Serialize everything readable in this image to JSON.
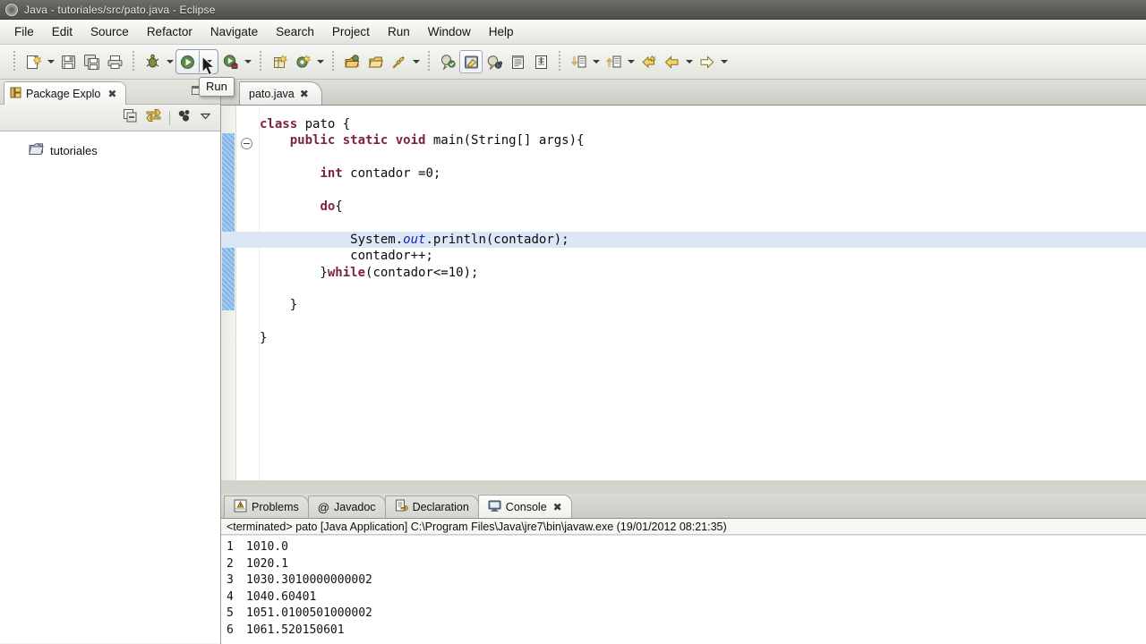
{
  "window": {
    "title": "Java - tutoriales/src/pato.java - Eclipse",
    "app_icon": "eclipse-icon"
  },
  "menubar": {
    "items": [
      {
        "label": "File"
      },
      {
        "label": "Edit"
      },
      {
        "label": "Source"
      },
      {
        "label": "Refactor"
      },
      {
        "label": "Navigate"
      },
      {
        "label": "Search"
      },
      {
        "label": "Project"
      },
      {
        "label": "Run"
      },
      {
        "label": "Window"
      },
      {
        "label": "Help"
      }
    ]
  },
  "toolbar": {
    "tooltip": "Run",
    "buttons": [
      {
        "name": "new-wizard-icon"
      },
      {
        "name": "new-wizard-dropdown-icon"
      },
      {
        "name": "save-icon"
      },
      {
        "name": "save-all-icon"
      },
      {
        "name": "print-icon"
      },
      {
        "name": "debug-icon"
      },
      {
        "name": "debug-dropdown-icon"
      },
      {
        "name": "run-icon"
      },
      {
        "name": "run-dropdown-icon"
      },
      {
        "name": "external-tools-icon"
      },
      {
        "name": "external-tools-dropdown-icon"
      },
      {
        "name": "new-java-project-icon"
      },
      {
        "name": "new-class-icon"
      },
      {
        "name": "new-class-dropdown-icon"
      },
      {
        "name": "open-type-icon"
      },
      {
        "name": "open-task-icon"
      },
      {
        "name": "search-icon"
      },
      {
        "name": "search-dropdown-icon"
      },
      {
        "name": "toggle-mark-occurrences-icon"
      },
      {
        "name": "skip-all-breakpoints-icon"
      },
      {
        "name": "toggle-breadcrumb-icon"
      },
      {
        "name": "show-whitespace-icon"
      },
      {
        "name": "next-annotation-icon"
      },
      {
        "name": "next-annotation-dropdown-icon"
      },
      {
        "name": "previous-annotation-icon"
      },
      {
        "name": "previous-annotation-dropdown-icon"
      },
      {
        "name": "last-edit-location-icon"
      },
      {
        "name": "back-icon"
      },
      {
        "name": "back-dropdown-icon"
      },
      {
        "name": "forward-icon"
      },
      {
        "name": "forward-dropdown-icon"
      }
    ]
  },
  "left_panel": {
    "tab_label": "Package Explo",
    "tab_icon": "package-explorer-icon",
    "close_label": "✖",
    "toolbar_icons": [
      "collapse-all-icon",
      "link-with-editor-icon",
      "view-menu-icon",
      "view-dropdown-icon"
    ],
    "tree": [
      {
        "label": "tutoriales",
        "icon": "java-project-folder-icon"
      }
    ]
  },
  "editor": {
    "tab_label": "pato.java",
    "tab_close": "✖",
    "highlight_line_index": 7,
    "lines": [
      [
        {
          "t": "class",
          "c": "kw"
        },
        {
          "t": " pato {",
          "c": ""
        }
      ],
      [
        {
          "t": "    ",
          "c": ""
        },
        {
          "t": "public static void",
          "c": "kw"
        },
        {
          "t": " main(String[] args){",
          "c": ""
        }
      ],
      [
        {
          "t": "",
          "c": ""
        }
      ],
      [
        {
          "t": "        ",
          "c": ""
        },
        {
          "t": "int",
          "c": "kw"
        },
        {
          "t": " contador =0;",
          "c": ""
        }
      ],
      [
        {
          "t": "",
          "c": ""
        }
      ],
      [
        {
          "t": "        ",
          "c": ""
        },
        {
          "t": "do",
          "c": "kw"
        },
        {
          "t": "{",
          "c": ""
        }
      ],
      [
        {
          "t": "",
          "c": ""
        }
      ],
      [
        {
          "t": "            System.",
          "c": ""
        },
        {
          "t": "out",
          "c": "fld"
        },
        {
          "t": ".println(contador);",
          "c": ""
        }
      ],
      [
        {
          "t": "            contador++;",
          "c": ""
        }
      ],
      [
        {
          "t": "        }",
          "c": ""
        },
        {
          "t": "while",
          "c": "kw"
        },
        {
          "t": "(contador<=10);",
          "c": ""
        }
      ],
      [
        {
          "t": "",
          "c": ""
        }
      ],
      [
        {
          "t": "    }",
          "c": ""
        }
      ],
      [
        {
          "t": "",
          "c": ""
        }
      ],
      [
        {
          "t": "}",
          "c": ""
        }
      ]
    ]
  },
  "bottom_panel": {
    "tabs": [
      {
        "label": "Problems",
        "icon": "problems-icon",
        "active": false,
        "closable": false
      },
      {
        "label": "Javadoc",
        "icon": "javadoc-at-icon",
        "active": false,
        "closable": false
      },
      {
        "label": "Declaration",
        "icon": "declaration-icon",
        "active": false,
        "closable": false
      },
      {
        "label": "Console",
        "icon": "console-icon",
        "active": true,
        "closable": true
      }
    ],
    "close_label": "✖",
    "console_header": "<terminated> pato [Java Application] C:\\Program Files\\Java\\jre7\\bin\\javaw.exe (19/01/2012 08:21:35)",
    "console_rows": [
      {
        "num": "1",
        "value": "1010.0"
      },
      {
        "num": "2",
        "value": "1020.1"
      },
      {
        "num": "3",
        "value": "1030.3010000000002"
      },
      {
        "num": "4",
        "value": "1040.60401"
      },
      {
        "num": "5",
        "value": "1051.0100501000002"
      },
      {
        "num": "6",
        "value": "1061.520150601"
      }
    ]
  },
  "colors": {
    "keyword": "#7e2147",
    "field": "#1a27b8",
    "line_highlight": "#dbe7f6",
    "range_bar": "#7fb2e5",
    "titlebar": "#5e5e59"
  }
}
